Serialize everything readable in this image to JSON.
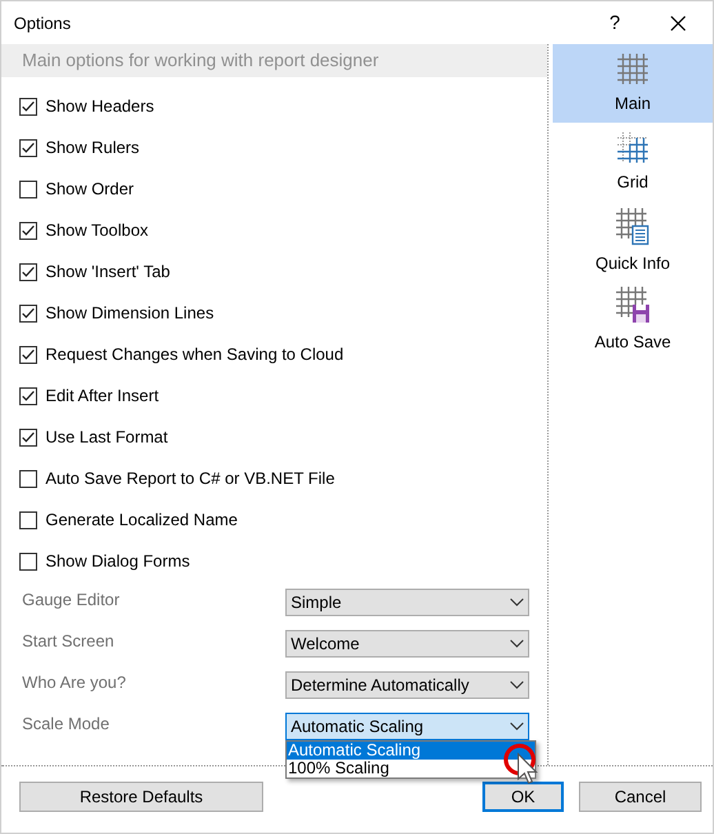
{
  "window": {
    "title": "Options",
    "help_button": "?"
  },
  "header": "Main options for working with report designer",
  "checkboxes": [
    {
      "label": "Show Headers",
      "checked": true
    },
    {
      "label": "Show Rulers",
      "checked": true
    },
    {
      "label": "Show Order",
      "checked": false
    },
    {
      "label": "Show Toolbox",
      "checked": true
    },
    {
      "label": "Show 'Insert' Tab",
      "checked": true
    },
    {
      "label": "Show Dimension Lines",
      "checked": true
    },
    {
      "label": "Request Changes when Saving to Cloud",
      "checked": true
    },
    {
      "label": "Edit After Insert",
      "checked": true
    },
    {
      "label": "Use Last Format",
      "checked": true
    },
    {
      "label": "Auto Save Report to C# or VB.NET File",
      "checked": false
    },
    {
      "label": "Generate Localized Name",
      "checked": false
    },
    {
      "label": "Show Dialog Forms",
      "checked": false
    }
  ],
  "dropdowns": [
    {
      "label": "Gauge Editor",
      "value": "Simple",
      "expanded": false
    },
    {
      "label": "Start Screen",
      "value": "Welcome",
      "expanded": false
    },
    {
      "label": "Who Are you?",
      "value": "Determine Automatically",
      "expanded": false
    },
    {
      "label": "Scale Mode",
      "value": "Automatic Scaling",
      "expanded": true,
      "options": [
        {
          "label": "Automatic Scaling",
          "selected": true
        },
        {
          "label": "100% Scaling",
          "selected": false
        }
      ]
    }
  ],
  "sidebar": {
    "items": [
      {
        "label": "Main",
        "kind": "main",
        "selected": true
      },
      {
        "label": "Grid",
        "kind": "grid",
        "selected": false
      },
      {
        "label": "Quick Info",
        "kind": "info",
        "selected": false
      },
      {
        "label": "Auto Save",
        "kind": "save",
        "selected": false
      }
    ]
  },
  "buttons": [
    {
      "label": "Restore Defaults",
      "kind": "restore"
    },
    {
      "label": "OK",
      "kind": "ok"
    },
    {
      "label": "Cancel",
      "kind": "cancel"
    }
  ]
}
